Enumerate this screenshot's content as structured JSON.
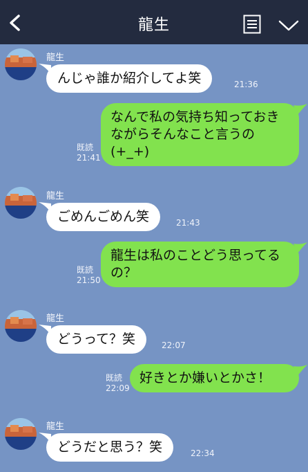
{
  "header": {
    "title": "龍生"
  },
  "messages": [
    {
      "sender": "龍生",
      "text": "んじゃ誰か紹介してよ笑",
      "time": "21:36"
    },
    {
      "text": "なんで私の気持ち知っておきながらそんなこと言うの(+_+)",
      "read": "既読",
      "time": "21:41"
    },
    {
      "sender": "龍生",
      "text": "ごめんごめん笑",
      "time": "21:43"
    },
    {
      "text": "龍生は私のことどう思ってるの？",
      "read": "既読",
      "time": "21:50"
    },
    {
      "sender": "龍生",
      "text": "どうって？笑",
      "time": "22:07"
    },
    {
      "text": "好きとか嫌いとかさ！",
      "read": "既読",
      "time": "22:09"
    },
    {
      "sender": "龍生",
      "text": "どうだと思う？笑",
      "time": "22:34"
    }
  ]
}
